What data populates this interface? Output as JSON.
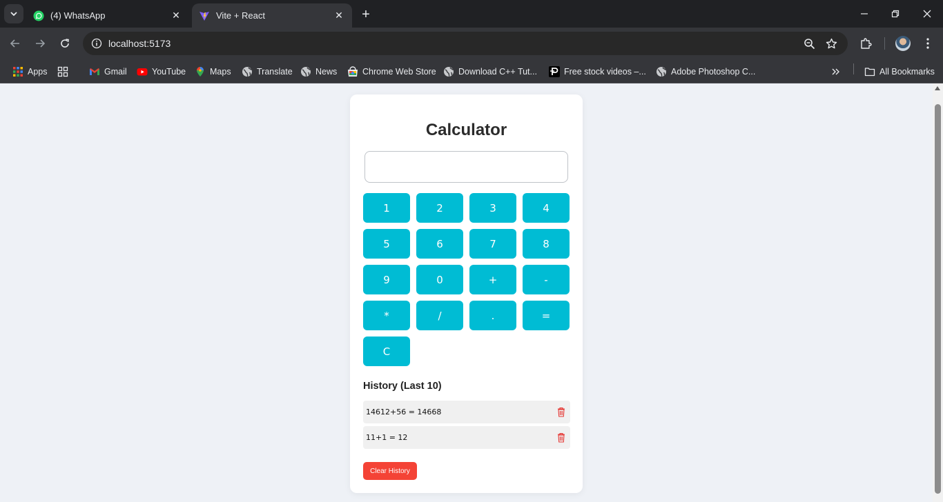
{
  "browser": {
    "tabs": [
      {
        "title": "(4) WhatsApp",
        "favicon": "whatsapp-icon",
        "active": false
      },
      {
        "title": "Vite + React",
        "favicon": "vite-icon",
        "active": true
      }
    ],
    "url": "localhost:5173",
    "bookmarks": [
      {
        "label": "Apps",
        "icon": "apps-grid-icon"
      },
      {
        "label": "Gmail",
        "icon": "gmail-icon"
      },
      {
        "label": "YouTube",
        "icon": "youtube-icon"
      },
      {
        "label": "Maps",
        "icon": "maps-icon"
      },
      {
        "label": "Translate",
        "icon": "globe-icon"
      },
      {
        "label": "News",
        "icon": "globe-icon"
      },
      {
        "label": "Chrome Web Store",
        "icon": "chrome-web-store-icon"
      },
      {
        "label": "Download C++ Tut...",
        "icon": "globe-icon"
      },
      {
        "label": "Free stock videos –...",
        "icon": "stock-videos-icon"
      },
      {
        "label": "Adobe Photoshop C...",
        "icon": "globe-icon"
      }
    ],
    "all_bookmarks": "All Bookmarks"
  },
  "calculator": {
    "title": "Calculator",
    "display_value": "",
    "keys": [
      "1",
      "2",
      "3",
      "4",
      "5",
      "6",
      "7",
      "8",
      "9",
      "0",
      "+",
      "-",
      "*",
      "/",
      ".",
      "=",
      "C"
    ],
    "history_title": "History (Last 10)",
    "history": [
      {
        "expression": "14612+56 = 14668"
      },
      {
        "expression": "11+1 = 12"
      }
    ],
    "clear_history_label": "Clear History"
  },
  "colors": {
    "key_bg": "#00bcd4",
    "clear_btn_bg": "#f44336",
    "trash_icon": "#e53935",
    "page_bg": "#eef1f6"
  }
}
